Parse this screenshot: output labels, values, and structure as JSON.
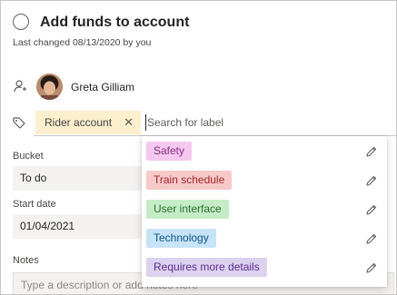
{
  "task": {
    "title": "Add funds to account",
    "last_changed": "Last changed 08/13/2020 by you"
  },
  "assignee": {
    "name": "Greta Gilliam"
  },
  "labels": {
    "applied": "Rider account",
    "search_placeholder": "Search for label",
    "options": [
      {
        "name": "Safety",
        "bg": "#f4c8ef",
        "fg": "#8a2e85"
      },
      {
        "name": "Train schedule",
        "bg": "#f7c9c9",
        "fg": "#a4262c"
      },
      {
        "name": "User interface",
        "bg": "#c5ecc7",
        "fg": "#2f6f2f"
      },
      {
        "name": "Technology",
        "bg": "#c7e3f7",
        "fg": "#0f548c"
      },
      {
        "name": "Requires more details",
        "bg": "#dcd1ef",
        "fg": "#5c2e91"
      }
    ]
  },
  "bucket": {
    "label": "Bucket",
    "value": "To do"
  },
  "start_date": {
    "label": "Start date",
    "value": "01/04/2021"
  },
  "notes": {
    "label": "Notes",
    "placeholder": "Type a description or add notes here"
  }
}
